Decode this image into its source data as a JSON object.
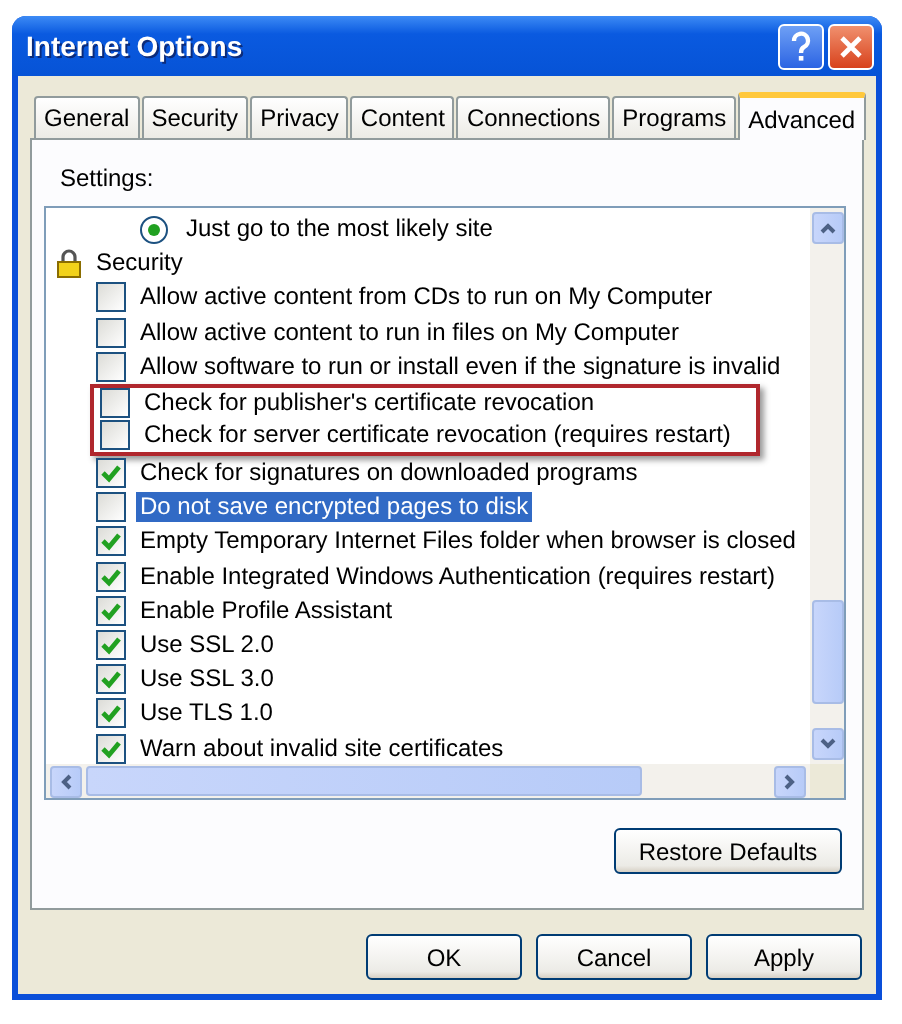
{
  "window": {
    "title": "Internet Options"
  },
  "tabs": [
    {
      "label": "General",
      "selected": false
    },
    {
      "label": "Security",
      "selected": false
    },
    {
      "label": "Privacy",
      "selected": false
    },
    {
      "label": "Content",
      "selected": false
    },
    {
      "label": "Connections",
      "selected": false
    },
    {
      "label": "Programs",
      "selected": false
    },
    {
      "label": "Advanced",
      "selected": true
    }
  ],
  "settings_label": "Settings:",
  "settings": [
    {
      "kind": "radio",
      "label": "Just go to the most likely site",
      "checked": true,
      "selected": false,
      "highlighted": false
    },
    {
      "kind": "group",
      "label": "Security",
      "selected": false,
      "highlighted": false
    },
    {
      "kind": "checkbox",
      "label": "Allow active content from CDs to run on My Computer",
      "checked": false,
      "selected": false,
      "highlighted": false
    },
    {
      "kind": "checkbox",
      "label": "Allow active content to run in files on My Computer",
      "checked": false,
      "selected": false,
      "highlighted": false
    },
    {
      "kind": "checkbox",
      "label": "Allow software to run or install even if the signature is invalid",
      "checked": false,
      "selected": false,
      "highlighted": false
    },
    {
      "kind": "checkbox",
      "label": "Check for publisher's certificate revocation",
      "checked": false,
      "selected": false,
      "highlighted": true
    },
    {
      "kind": "checkbox",
      "label": "Check for server certificate revocation (requires restart)",
      "checked": false,
      "selected": false,
      "highlighted": true
    },
    {
      "kind": "checkbox",
      "label": "Check for signatures on downloaded programs",
      "checked": true,
      "selected": false,
      "highlighted": false
    },
    {
      "kind": "checkbox",
      "label": "Do not save encrypted pages to disk",
      "checked": false,
      "selected": true,
      "highlighted": false
    },
    {
      "kind": "checkbox",
      "label": "Empty Temporary Internet Files folder when browser is closed",
      "checked": true,
      "selected": false,
      "highlighted": false
    },
    {
      "kind": "checkbox",
      "label": "Enable Integrated Windows Authentication (requires restart)",
      "checked": true,
      "selected": false,
      "highlighted": false
    },
    {
      "kind": "checkbox",
      "label": "Enable Profile Assistant",
      "checked": true,
      "selected": false,
      "highlighted": false
    },
    {
      "kind": "checkbox",
      "label": "Use SSL 2.0",
      "checked": true,
      "selected": false,
      "highlighted": false
    },
    {
      "kind": "checkbox",
      "label": "Use SSL 3.0",
      "checked": true,
      "selected": false,
      "highlighted": false
    },
    {
      "kind": "checkbox",
      "label": "Use TLS 1.0",
      "checked": true,
      "selected": false,
      "highlighted": false
    },
    {
      "kind": "checkbox",
      "label": "Warn about invalid site certificates",
      "checked": true,
      "selected": false,
      "highlighted": false
    }
  ],
  "restore_button": "Restore Defaults",
  "buttons": [
    "OK",
    "Cancel",
    "Apply"
  ]
}
